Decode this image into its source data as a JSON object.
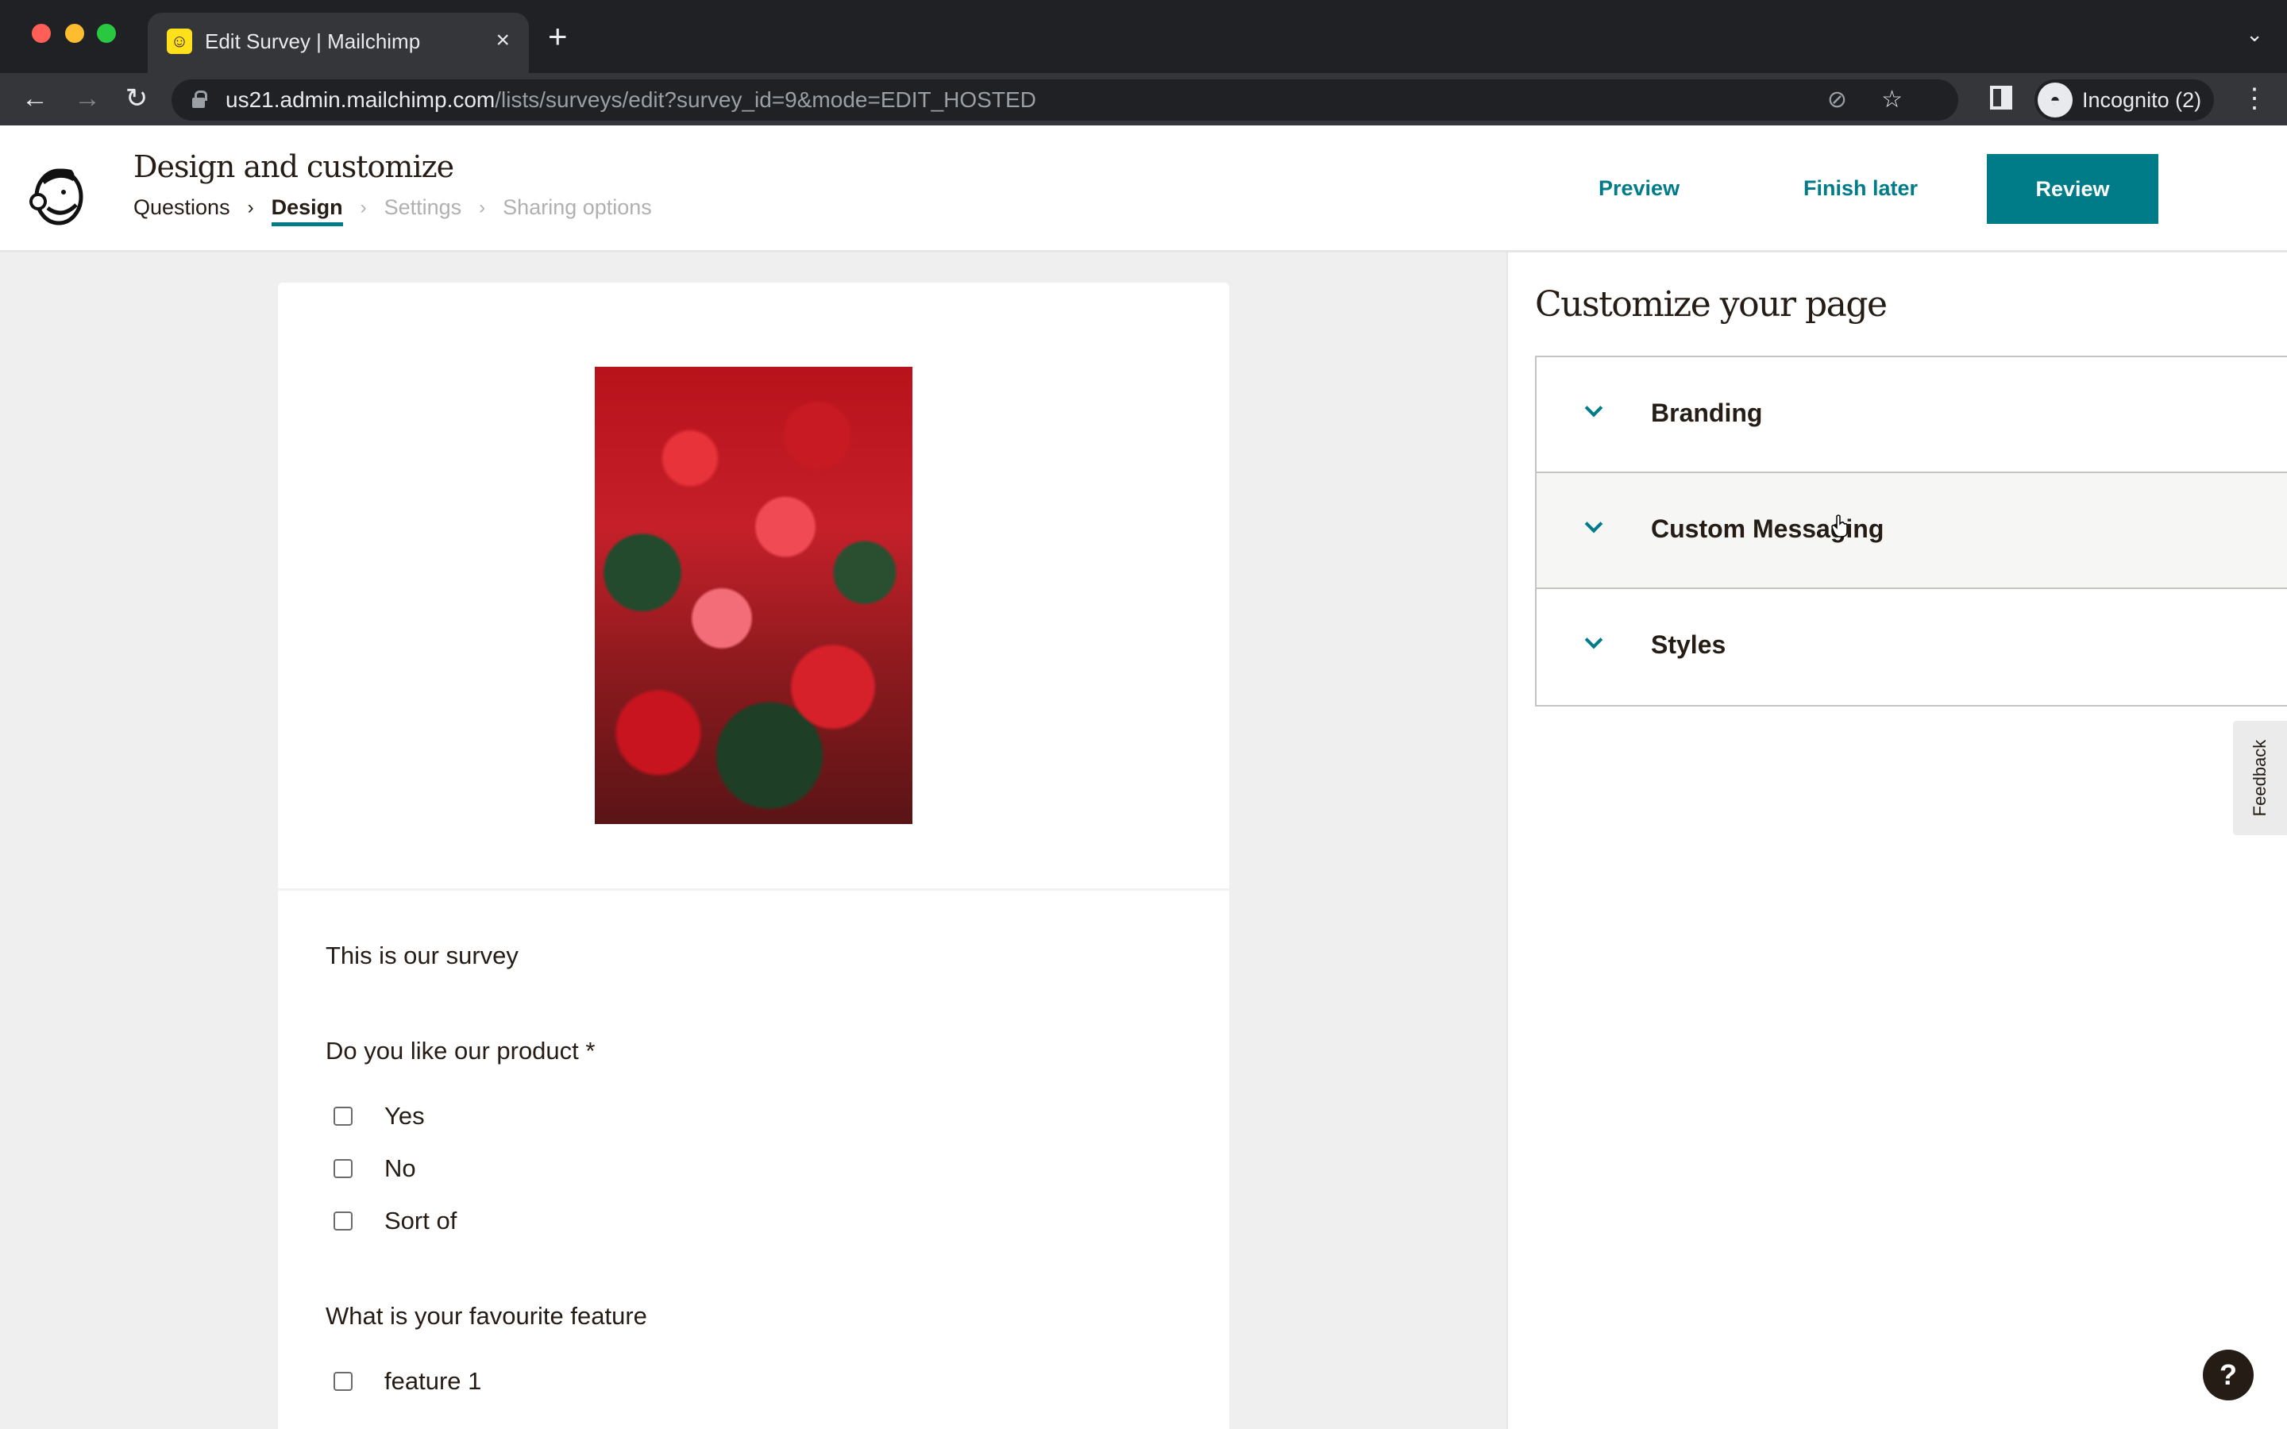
{
  "browser": {
    "tab_title": "Edit Survey | Mailchimp",
    "tab_close": "×",
    "new_tab": "+",
    "url_host": "us21.admin.mailchimp.com",
    "url_path": "/lists/surveys/edit?survey_id=9&mode=EDIT_HOSTED",
    "profile_label": "Incognito (2)",
    "icons": {
      "back": "←",
      "forward": "→",
      "reload": "↻",
      "eye_off": "⊘",
      "star": "☆",
      "menu": "⋮",
      "tab_list": "⌄",
      "incognito": "🕶"
    }
  },
  "header": {
    "title": "Design and customize",
    "breadcrumb": [
      {
        "label": "Questions",
        "state": "done"
      },
      {
        "label": "Design",
        "state": "active"
      },
      {
        "label": "Settings",
        "state": "disabled"
      },
      {
        "label": "Sharing options",
        "state": "disabled"
      }
    ],
    "breadcrumb_separator": "›",
    "preview_label": "Preview",
    "finish_later_label": "Finish later",
    "review_label": "Review"
  },
  "survey": {
    "intro": "This is our survey",
    "questions": [
      {
        "label": "Do you like our product *",
        "options": [
          {
            "label": "Yes",
            "checked": false
          },
          {
            "label": "No",
            "checked": false
          },
          {
            "label": "Sort of",
            "checked": false
          }
        ]
      },
      {
        "label": "What is your favourite feature",
        "options": [
          {
            "label": "feature 1",
            "checked": false
          }
        ]
      }
    ]
  },
  "panel": {
    "title": "Customize your page",
    "sections": [
      {
        "label": "Branding",
        "expanded": false
      },
      {
        "label": "Custom Messaging",
        "expanded": false,
        "hovered": true
      },
      {
        "label": "Styles",
        "expanded": false
      }
    ]
  },
  "feedback_label": "Feedback",
  "help_label": "?",
  "colors": {
    "brand_teal": "#007c89",
    "text_dark": "#241c15",
    "disabled_text": "#b0b0b0",
    "canvas_bg": "#efefef"
  }
}
